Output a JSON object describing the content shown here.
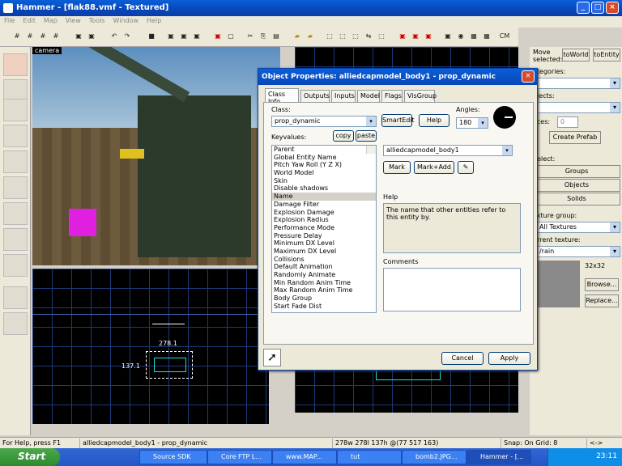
{
  "window": {
    "title": "Hammer - [flak88.vmf - Textured]"
  },
  "menu": [
    "File",
    "Edit",
    "Map",
    "View",
    "Tools",
    "Window",
    "Help"
  ],
  "toolbar": {
    "cm_label": "CM"
  },
  "viewports": {
    "camera_label": "camera",
    "dim_width": "278.1",
    "dim_height": "137.1"
  },
  "right_panel": {
    "move_selected": "Move selected:",
    "to_world": "toWorld",
    "to_entity": "toEntity",
    "categories": "ategories:",
    "objects": "bjects:",
    "faces": "aces:",
    "faces_value": "0",
    "create_prefab": "Create Prefab",
    "select": "Select:",
    "groups": "Groups",
    "objects_btn": "Objects",
    "solids": "Solids",
    "texture_group": "exture group:",
    "texture_group_value": "All Textures",
    "current_texture": "urrent texture:",
    "current_texture_value": "/rain",
    "texture_size": "32x32",
    "browse": "Browse...",
    "replace": "Replace..."
  },
  "dialog": {
    "title": "Object Properties: alliedcapmodel_body1 - prop_dynamic",
    "tabs": [
      "Class Info",
      "Outputs",
      "Inputs",
      "Model",
      "Flags",
      "VisGroup"
    ],
    "class_label": "Class:",
    "class_value": "prop_dynamic",
    "smartedit": "SmartEdit",
    "help_btn": "Help",
    "angles_label": "Angles:",
    "angles_value": "180",
    "keyvalues_label": "Keyvalues:",
    "copy": "copy",
    "paste": "paste",
    "keyvalues": [
      "Parent",
      "Global Entity Name",
      "Pitch Yaw Roll (Y Z X)",
      "World Model",
      "Skin",
      "Disable shadows",
      "Name",
      "Damage Filter",
      "Explosion Damage",
      "Explosion Radius",
      "Performance Mode",
      "Pressure Delay",
      "Minimum DX Level",
      "Maximum DX Level",
      "Collisions",
      "Default Animation",
      "Randomly Animate",
      "Min Random Anim Time",
      "Max Random Anim Time",
      "Body Group",
      "Start Fade Dist"
    ],
    "selected_index": 6,
    "value_field": "alliedcapmodel_body1",
    "mark": "Mark",
    "mark_add": "Mark+Add",
    "help_label": "Help",
    "help_text": "The name that other entities refer to this entity by.",
    "comments_label": "Comments",
    "cancel": "Cancel",
    "apply": "Apply"
  },
  "status": {
    "help": "For Help, press F1",
    "selection": "alliedcapmodel_body1 - prop_dynamic",
    "dims": "278w 278l 137h @(77 517 163)",
    "snap": "Snap: On Grid: 8",
    "arrows": "<->"
  },
  "taskbar": {
    "start": "Start",
    "tasks": [
      "Source SDK",
      "Core FTP L...",
      "www.MAP...",
      "tut",
      "bomb2.JPG...",
      "Hammer - [..."
    ],
    "clock": "23:11"
  },
  "colors": {
    "accent": "#0a5fd8",
    "grid": "#1c3a78",
    "selection": "#ff00ff"
  }
}
